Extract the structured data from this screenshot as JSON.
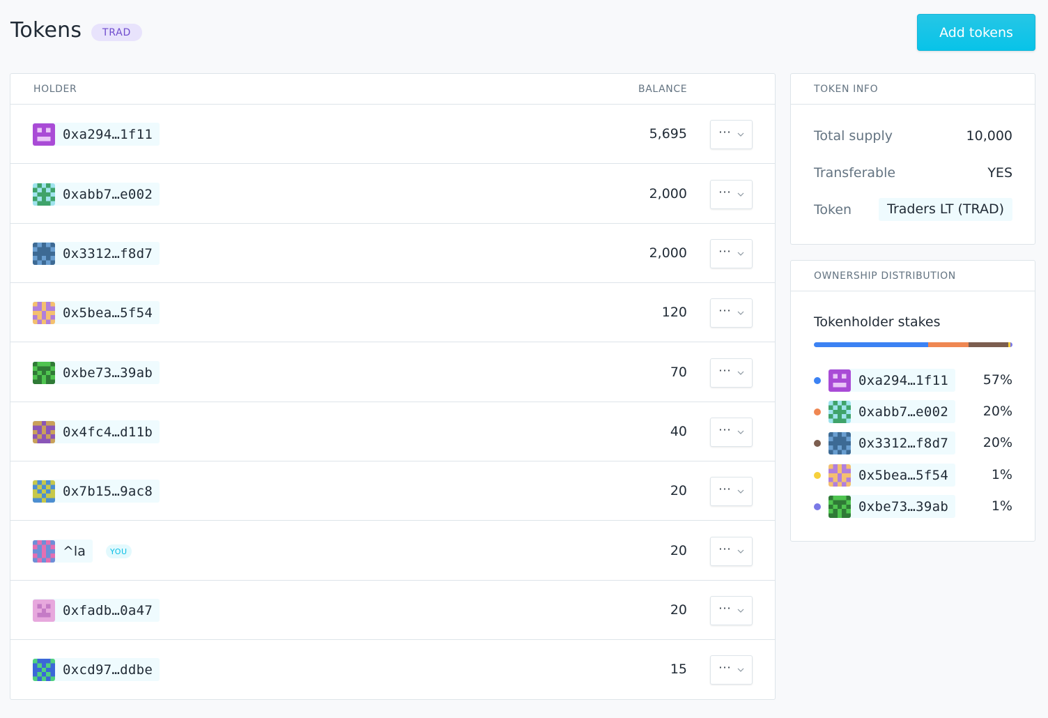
{
  "header": {
    "title": "Tokens",
    "symbol": "TRAD",
    "add_button": "Add tokens"
  },
  "holders": {
    "columns": {
      "holder": "HOLDER",
      "balance": "BALANCE"
    },
    "rows": [
      {
        "address": "0xa294…1f11",
        "balance": "5,695",
        "avatar": {
          "bg": "#a94bd6",
          "fg": "#e9c6f7",
          "pattern": "face"
        }
      },
      {
        "address": "0xabb7…e002",
        "balance": "2,000",
        "avatar": {
          "bg": "#9fe3ee",
          "fg": "#3fa36a",
          "pattern": "a"
        }
      },
      {
        "address": "0x3312…f8d7",
        "balance": "2,000",
        "avatar": {
          "bg": "#6a9fd1",
          "fg": "#3d6a94",
          "pattern": "b"
        }
      },
      {
        "address": "0x5bea…5f54",
        "balance": "120",
        "avatar": {
          "bg": "#f4c06f",
          "fg": "#b07fdc",
          "pattern": "c"
        }
      },
      {
        "address": "0xbe73…39ab",
        "balance": "70",
        "avatar": {
          "bg": "#4fc450",
          "fg": "#2f7a36",
          "pattern": "d"
        }
      },
      {
        "address": "0x4fc4…d11b",
        "balance": "40",
        "avatar": {
          "bg": "#c9a15a",
          "fg": "#8a56b7",
          "pattern": "e"
        }
      },
      {
        "address": "0x7b15…9ac8",
        "balance": "20",
        "avatar": {
          "bg": "#c7c84a",
          "fg": "#4c8ed1",
          "pattern": "f"
        }
      },
      {
        "name": "^la",
        "you": "YOU",
        "balance": "20",
        "avatar": {
          "bg": "#e46fb1",
          "fg": "#6d8fd8",
          "pattern": "g"
        }
      },
      {
        "address": "0xfadb…0a47",
        "balance": "20",
        "avatar": {
          "bg": "#e7a8dd",
          "fg": "#c57bc6",
          "pattern": "h"
        }
      },
      {
        "address": "0xcd97…ddbe",
        "balance": "15",
        "avatar": {
          "bg": "#4fd17e",
          "fg": "#3b67d8",
          "pattern": "i"
        }
      }
    ]
  },
  "token_info": {
    "title": "TOKEN INFO",
    "total_supply_label": "Total supply",
    "total_supply": "10,000",
    "transferable_label": "Transferable",
    "transferable": "YES",
    "token_label": "Token",
    "token": "Traders LT (TRAD)"
  },
  "distribution": {
    "title": "OWNERSHIP DISTRIBUTION",
    "subtitle": "Tokenholder stakes",
    "stakes": [
      {
        "address": "0xa294…1f11",
        "percent": "57%",
        "share": 0.57,
        "color": "#3c82f3"
      },
      {
        "address": "0xabb7…e002",
        "percent": "20%",
        "share": 0.2,
        "color": "#ef8752"
      },
      {
        "address": "0x3312…f8d7",
        "percent": "20%",
        "share": 0.2,
        "color": "#7c5e4f"
      },
      {
        "address": "0x5bea…5f54",
        "percent": "1%",
        "share": 0.01,
        "color": "#f6d03c"
      },
      {
        "address": "0xbe73…39ab",
        "percent": "1%",
        "share": 0.01,
        "color": "#7a79e6"
      }
    ]
  }
}
